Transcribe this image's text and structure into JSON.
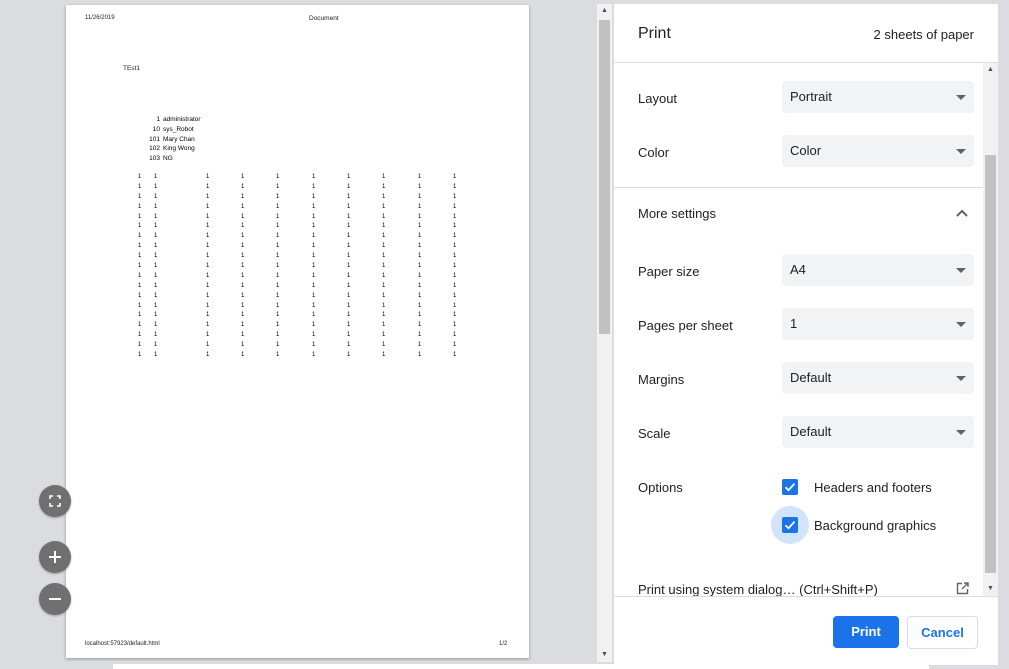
{
  "preview": {
    "header_date": "11/26/2019",
    "header_title": "Document",
    "heading": "TEst1",
    "users": [
      {
        "id": "1",
        "name": "administrator"
      },
      {
        "id": "10",
        "name": "sys_Robot"
      },
      {
        "id": "101",
        "name": "Mary Chan"
      },
      {
        "id": "102",
        "name": "King Wong"
      },
      {
        "id": "103",
        "name": "NG"
      }
    ],
    "grid_rows": 19,
    "grid_value": "1",
    "footer_url": "localhost:57923/default.html",
    "footer_page": "1/2"
  },
  "zoom": {
    "fit_icon": "fit-to-page-icon",
    "plus_icon": "zoom-in-icon",
    "minus_icon": "zoom-out-icon"
  },
  "panel": {
    "title": "Print",
    "sheet_count": "2 sheets of paper",
    "layout": {
      "label": "Layout",
      "value": "Portrait"
    },
    "color": {
      "label": "Color",
      "value": "Color"
    },
    "more_settings": "More settings",
    "paper_size": {
      "label": "Paper size",
      "value": "A4"
    },
    "pages_per_sheet": {
      "label": "Pages per sheet",
      "value": "1"
    },
    "margins": {
      "label": "Margins",
      "value": "Default"
    },
    "scale": {
      "label": "Scale",
      "value": "Default"
    },
    "options_label": "Options",
    "headers_footers": "Headers and footers",
    "background_graphics": "Background graphics",
    "system_dialog": "Print using system dialog… (Ctrl+Shift+P)",
    "print_button": "Print",
    "cancel_button": "Cancel"
  },
  "colors": {
    "accent": "#1a73e8",
    "backdrop": "#dadce0"
  }
}
